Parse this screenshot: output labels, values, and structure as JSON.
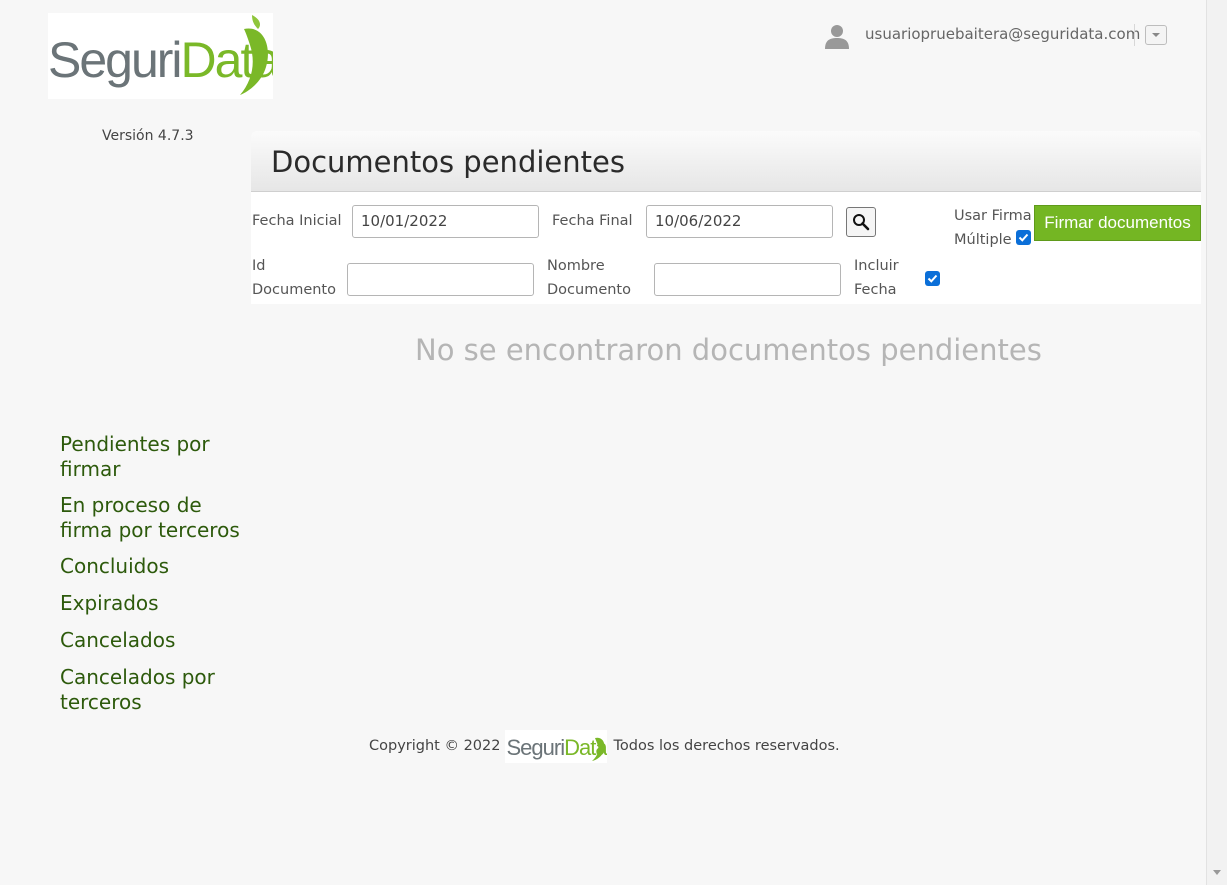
{
  "logo": {
    "part1": "Seguri",
    "part2": "Data"
  },
  "version": "Versión 4.7.3",
  "header": {
    "user_email": "usuariopruebaitera@seguridata.com"
  },
  "panel": {
    "title": "Documentos pendientes",
    "fecha_inicial_label": "Fecha Inicial",
    "fecha_inicial_value": "10/01/2022",
    "fecha_final_label": "Fecha Final",
    "fecha_final_value": "10/06/2022",
    "usar_firma_line1": "Usar Firma",
    "usar_firma_line2": "Múltiple",
    "usar_firma_checked": true,
    "firmar_button": "Firmar documentos",
    "id_doc_line1": "Id",
    "id_doc_line2": "Documento",
    "id_doc_value": "",
    "nombre_doc_line1": "Nombre",
    "nombre_doc_line2": "Documento",
    "nombre_doc_value": "",
    "incluir_fecha_line1": "Incluir",
    "incluir_fecha_line2": "Fecha",
    "incluir_fecha_checked": true
  },
  "empty_message": "No se encontraron documentos pendientes",
  "sidebar": {
    "items": [
      {
        "label": "Pendientes por firmar"
      },
      {
        "label": "En proceso de firma por terceros"
      },
      {
        "label": "Concluidos"
      },
      {
        "label": "Expirados"
      },
      {
        "label": "Cancelados"
      },
      {
        "label": "Cancelados por terceros"
      }
    ]
  },
  "footer": {
    "before": "Copyright © 2022",
    "after": "Todos los derechos reservados."
  },
  "colors": {
    "brand_green": "#74b623",
    "nav_green": "#2d5a0c",
    "logo_gray": "#6b7478"
  }
}
